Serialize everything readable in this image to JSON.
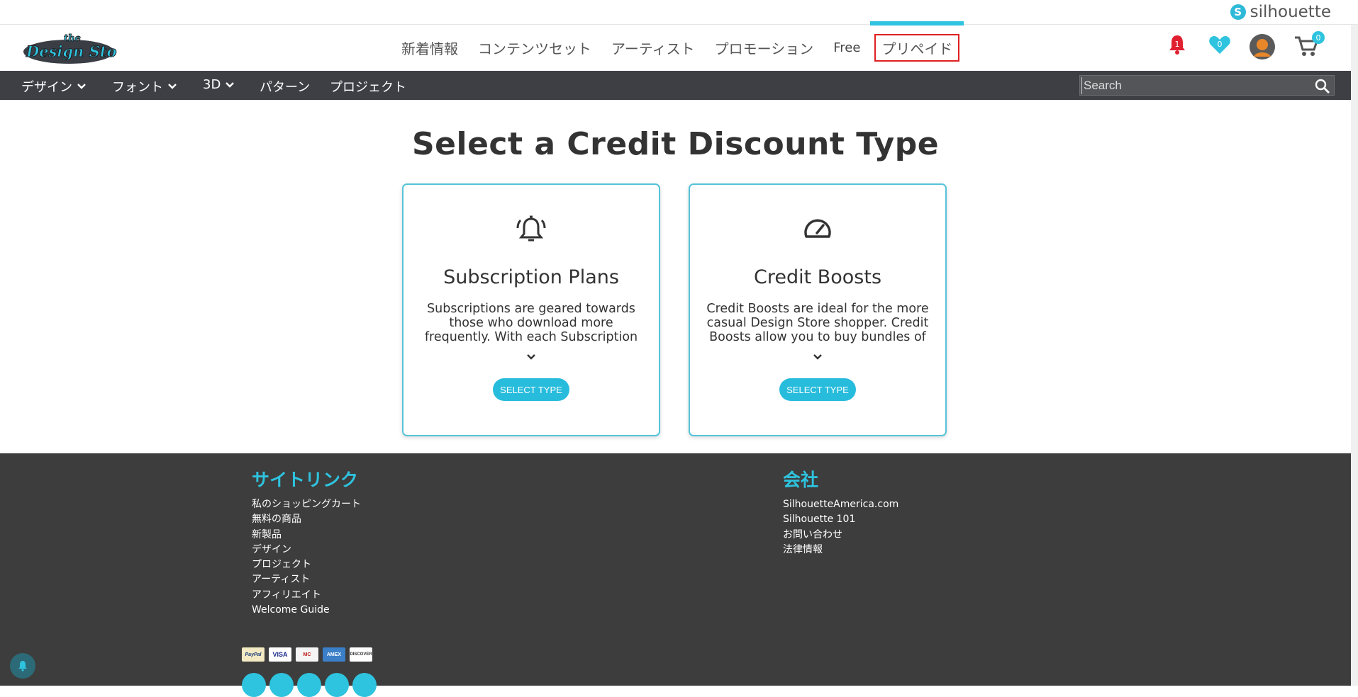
{
  "brand": {
    "name": "silhouette"
  },
  "logo": {
    "line1": "the",
    "line2": "Design Store"
  },
  "nav": [
    {
      "label": "新着情報"
    },
    {
      "label": "コンテンツセット"
    },
    {
      "label": "アーティスト"
    },
    {
      "label": "プロモーション"
    },
    {
      "label": "Free"
    },
    {
      "label": "プリペイド"
    }
  ],
  "header_icons": {
    "notifications_count": "1",
    "favorites_count": "0",
    "cart_count": "0"
  },
  "subnav": [
    {
      "label": "デザイン"
    },
    {
      "label": "フォント"
    },
    {
      "label": "3D"
    },
    {
      "label": "パターン"
    },
    {
      "label": "プロジェクト"
    }
  ],
  "search": {
    "placeholder": "Search"
  },
  "page_title": "Select a Credit Discount Type",
  "cards": [
    {
      "title": "Subscription Plans",
      "text": "Subscriptions are geared towards those who download more frequently. With each Subscription",
      "button": "SELECT TYPE"
    },
    {
      "title": "Credit Boosts",
      "text": "Credit Boosts are ideal for the more casual Design Store shopper. Credit Boosts allow you to buy bundles of",
      "button": "SELECT TYPE"
    }
  ],
  "footer": {
    "sitelinks": {
      "heading": "サイトリンク",
      "links": [
        "私のショッピングカート",
        "無料の商品",
        "新製品",
        "デザイン",
        "プロジェクト",
        "アーティスト",
        "アフィリエイト",
        "Welcome Guide"
      ]
    },
    "company": {
      "heading": "会社",
      "links": [
        "SilhouetteAmerica.com",
        "Silhouette 101",
        "お問い合わせ",
        "法律情報"
      ]
    },
    "payments": [
      "PayPal",
      "VISA",
      "MC",
      "AMEX",
      "DISCOVER"
    ]
  },
  "colors": {
    "accent": "#2ec3de",
    "dark": "#3d3f44",
    "footer": "#3d3d3d",
    "alert": "#e02030"
  }
}
